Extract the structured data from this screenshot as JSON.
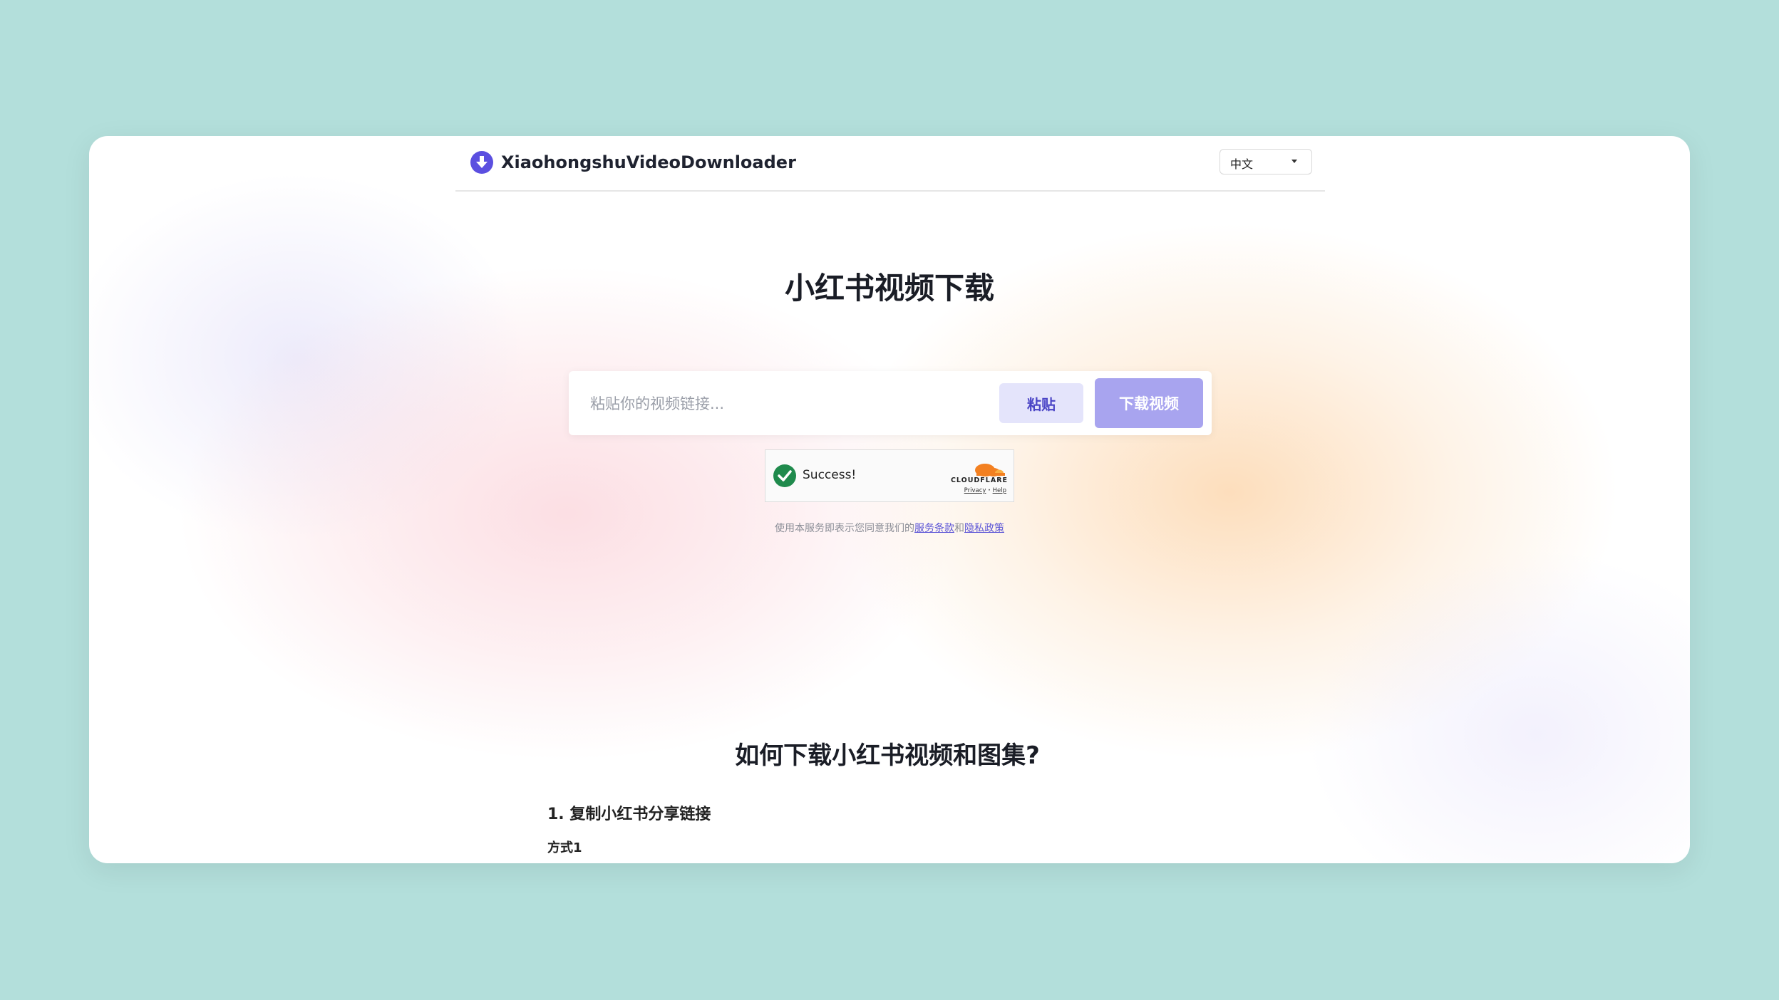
{
  "header": {
    "brand": "XiaohongshuVideoDownloader",
    "language": "中文"
  },
  "hero": {
    "title": "小红书视频下载"
  },
  "search": {
    "placeholder": "粘贴你的视频链接...",
    "paste_label": "粘贴",
    "download_label": "下载视频"
  },
  "captcha": {
    "status": "Success!",
    "brand": "CLOUDFLARE",
    "privacy": "Privacy",
    "separator": " · ",
    "help": "Help"
  },
  "terms": {
    "prefix": "使用本服务即表示您同意我们的",
    "tos": "服务条款",
    "and": "和",
    "privacy": "隐私政策"
  },
  "howto": {
    "title": "如何下载小红书视频和图集?",
    "step1": "1. 复制小红书分享链接",
    "method1": "方式1"
  },
  "colors": {
    "accent": "#5b54d6",
    "download_button": "#a8a4ef",
    "paste_button_bg": "#e4e4fb",
    "background": "#b3dfdb",
    "success_green": "#1f8a4c",
    "cloudflare_orange": "#f38020"
  }
}
